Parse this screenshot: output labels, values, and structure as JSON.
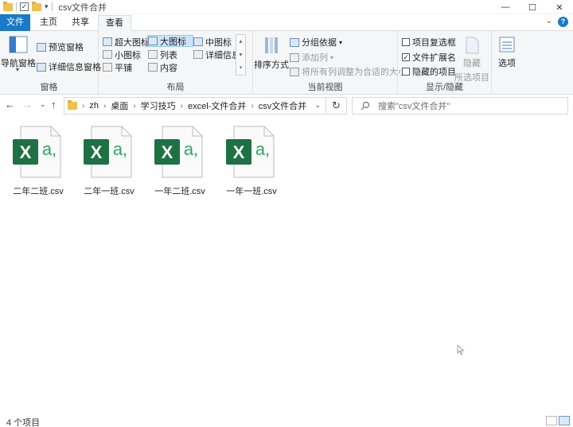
{
  "window": {
    "title": "csv文件合并",
    "controls": {
      "minimize": "—",
      "maximize": "☐",
      "close": "✕"
    }
  },
  "tabs": [
    {
      "label": "文件"
    },
    {
      "label": "主页"
    },
    {
      "label": "共享"
    },
    {
      "label": "查看"
    }
  ],
  "ribbon": {
    "pane_group": {
      "label": "窗格",
      "nav_pane": "导航窗格",
      "preview_pane": "预览窗格",
      "details_pane": "详细信息窗格"
    },
    "layout_group": {
      "label": "布局",
      "items": [
        "超大图标",
        "大图标",
        "中图标",
        "小图标",
        "列表",
        "详细信息",
        "平铺",
        "内容"
      ],
      "selected": "大图标"
    },
    "current_view_group": {
      "label": "当前视图",
      "sort_by": "排序方式",
      "group_by": "分组依据",
      "add_columns": "添加列",
      "size_columns": "将所有列调整为合适的大小"
    },
    "show_hide_group": {
      "label": "显示/隐藏",
      "item_checkboxes": "项目复选框",
      "file_extensions": "文件扩展名",
      "hidden_items": "隐藏的项目",
      "hide_selected_1": "隐藏",
      "hide_selected_2": "所选项目",
      "item_checkboxes_checked": false,
      "file_extensions_checked": true,
      "hidden_items_checked": false
    },
    "options": {
      "label": "选项"
    }
  },
  "address": {
    "breadcrumb": [
      "zh",
      "桌面",
      "学习技巧",
      "excel-文件合并",
      "csv文件合并"
    ],
    "search_placeholder": "搜索\"csv文件合并\""
  },
  "files": [
    {
      "name": "二年二班.csv"
    },
    {
      "name": "二年一班.csv"
    },
    {
      "name": "一年二班.csv"
    },
    {
      "name": "一年一班.csv"
    }
  ],
  "status": {
    "count_text": "4 个项目"
  },
  "colors": {
    "accent": "#1979ca",
    "excel_green": "#1e7145",
    "excel_light": "#33a468"
  }
}
